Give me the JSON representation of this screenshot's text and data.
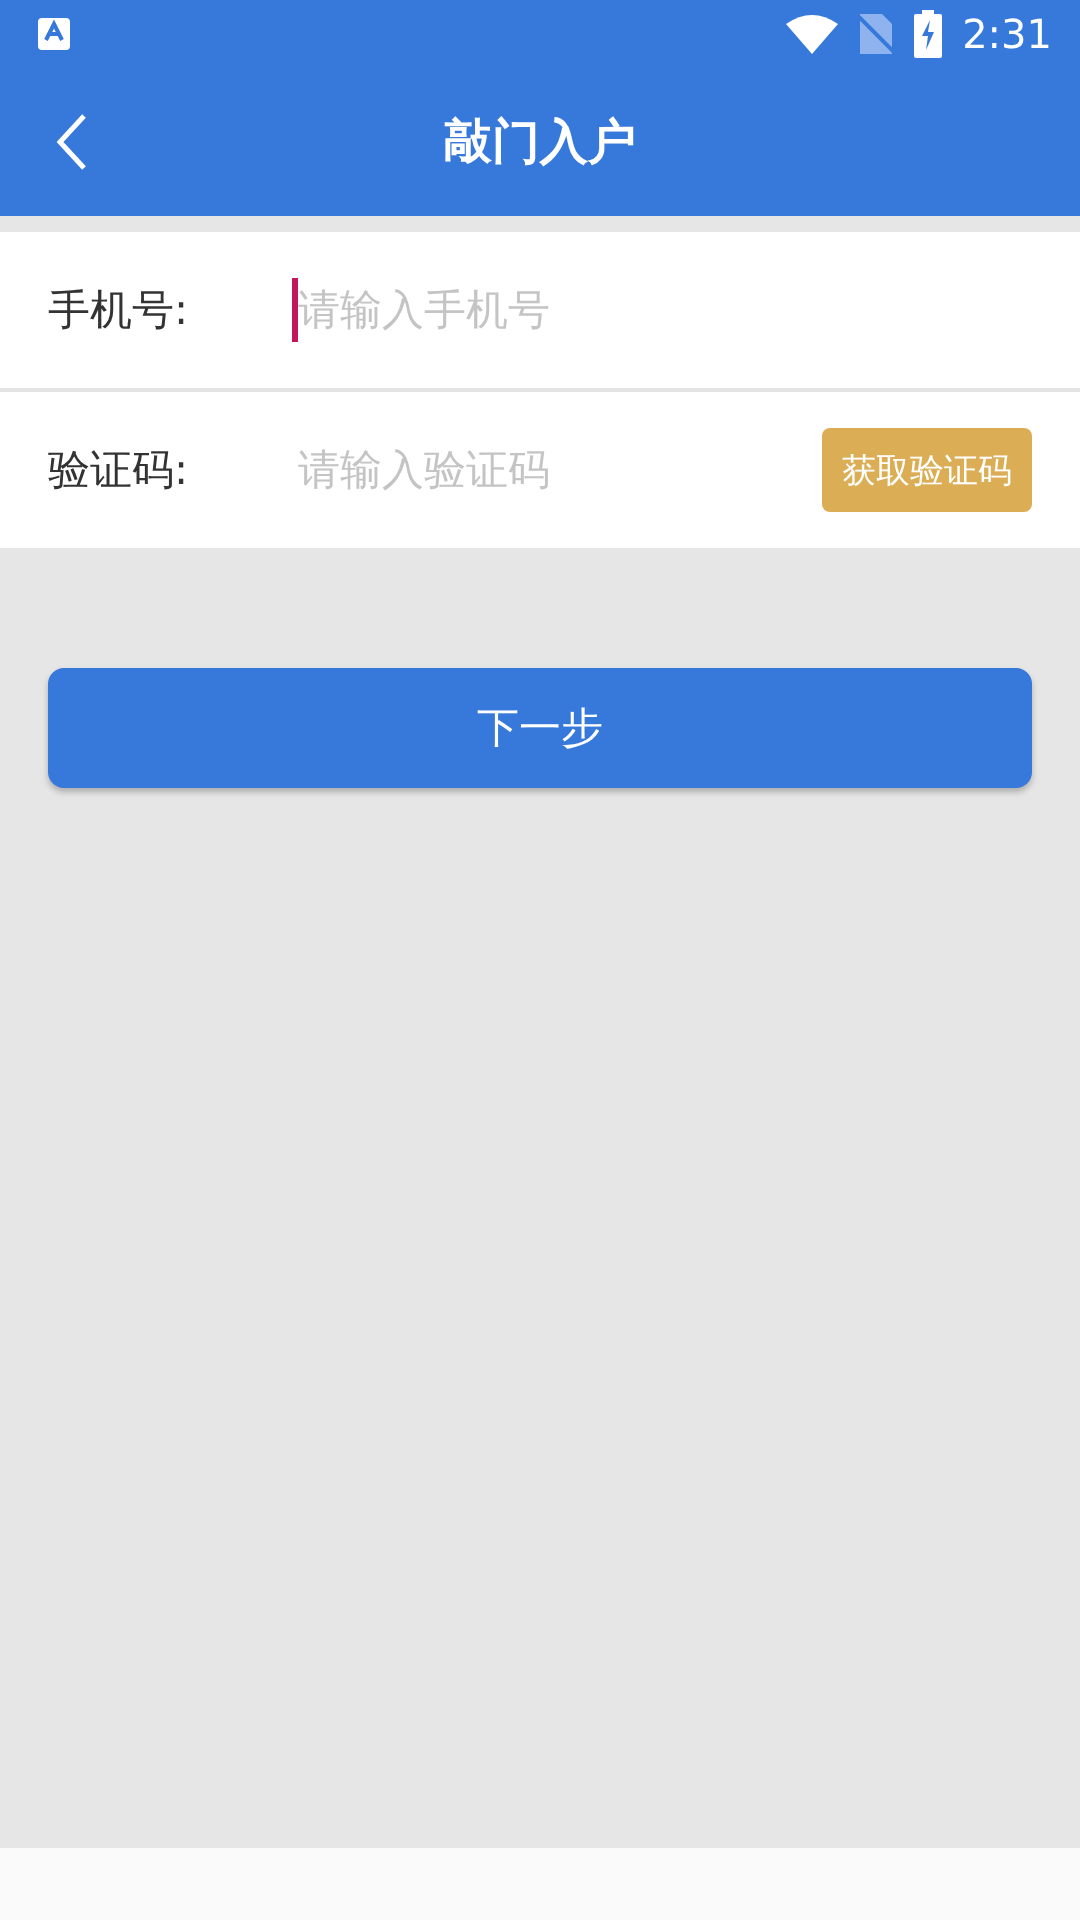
{
  "status_bar": {
    "time": "2:31"
  },
  "app_bar": {
    "title": "敲门入户"
  },
  "form": [
    {
      "kind": "phone",
      "label": "手机号:",
      "placeholder": "请输入手机号",
      "focused": true
    },
    {
      "kind": "code",
      "label": "验证码:",
      "placeholder": "请输入验证码",
      "focused": false,
      "action": "获取验证码"
    }
  ],
  "next_button": "下一步"
}
